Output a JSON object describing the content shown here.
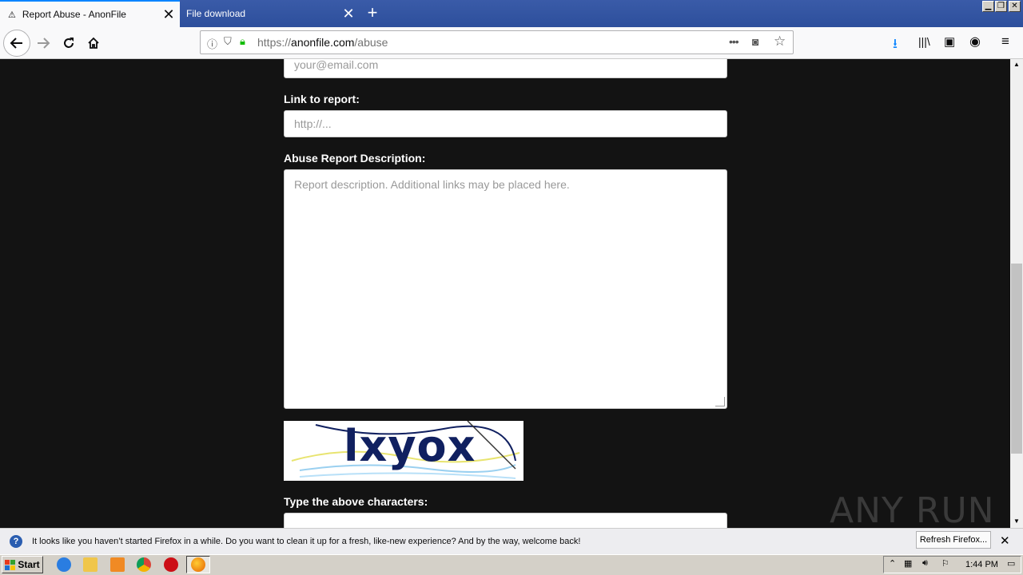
{
  "tabs": [
    {
      "title": "Report Abuse - AnonFile",
      "active": true
    },
    {
      "title": "File download",
      "active": false
    }
  ],
  "url": {
    "prefix": "https://",
    "host": "anonfile.com",
    "path": "/abuse"
  },
  "form": {
    "email_placeholder": "your@email.com",
    "link_label": "Link to report:",
    "link_placeholder": "http://...",
    "desc_label": "Abuse Report Description:",
    "desc_placeholder": "Report description. Additional links may be placed here.",
    "captcha_text": "lxyox",
    "captcha_label": "Type the above characters:"
  },
  "notification": {
    "text": "It looks like you haven’t started Firefox in a while. Do you want to clean it up for a fresh, like-new experience? And by the way, welcome back!",
    "button": "Refresh Firefox..."
  },
  "taskbar": {
    "start": "Start",
    "clock": "1:44 PM"
  },
  "watermark": "ANY RUN"
}
